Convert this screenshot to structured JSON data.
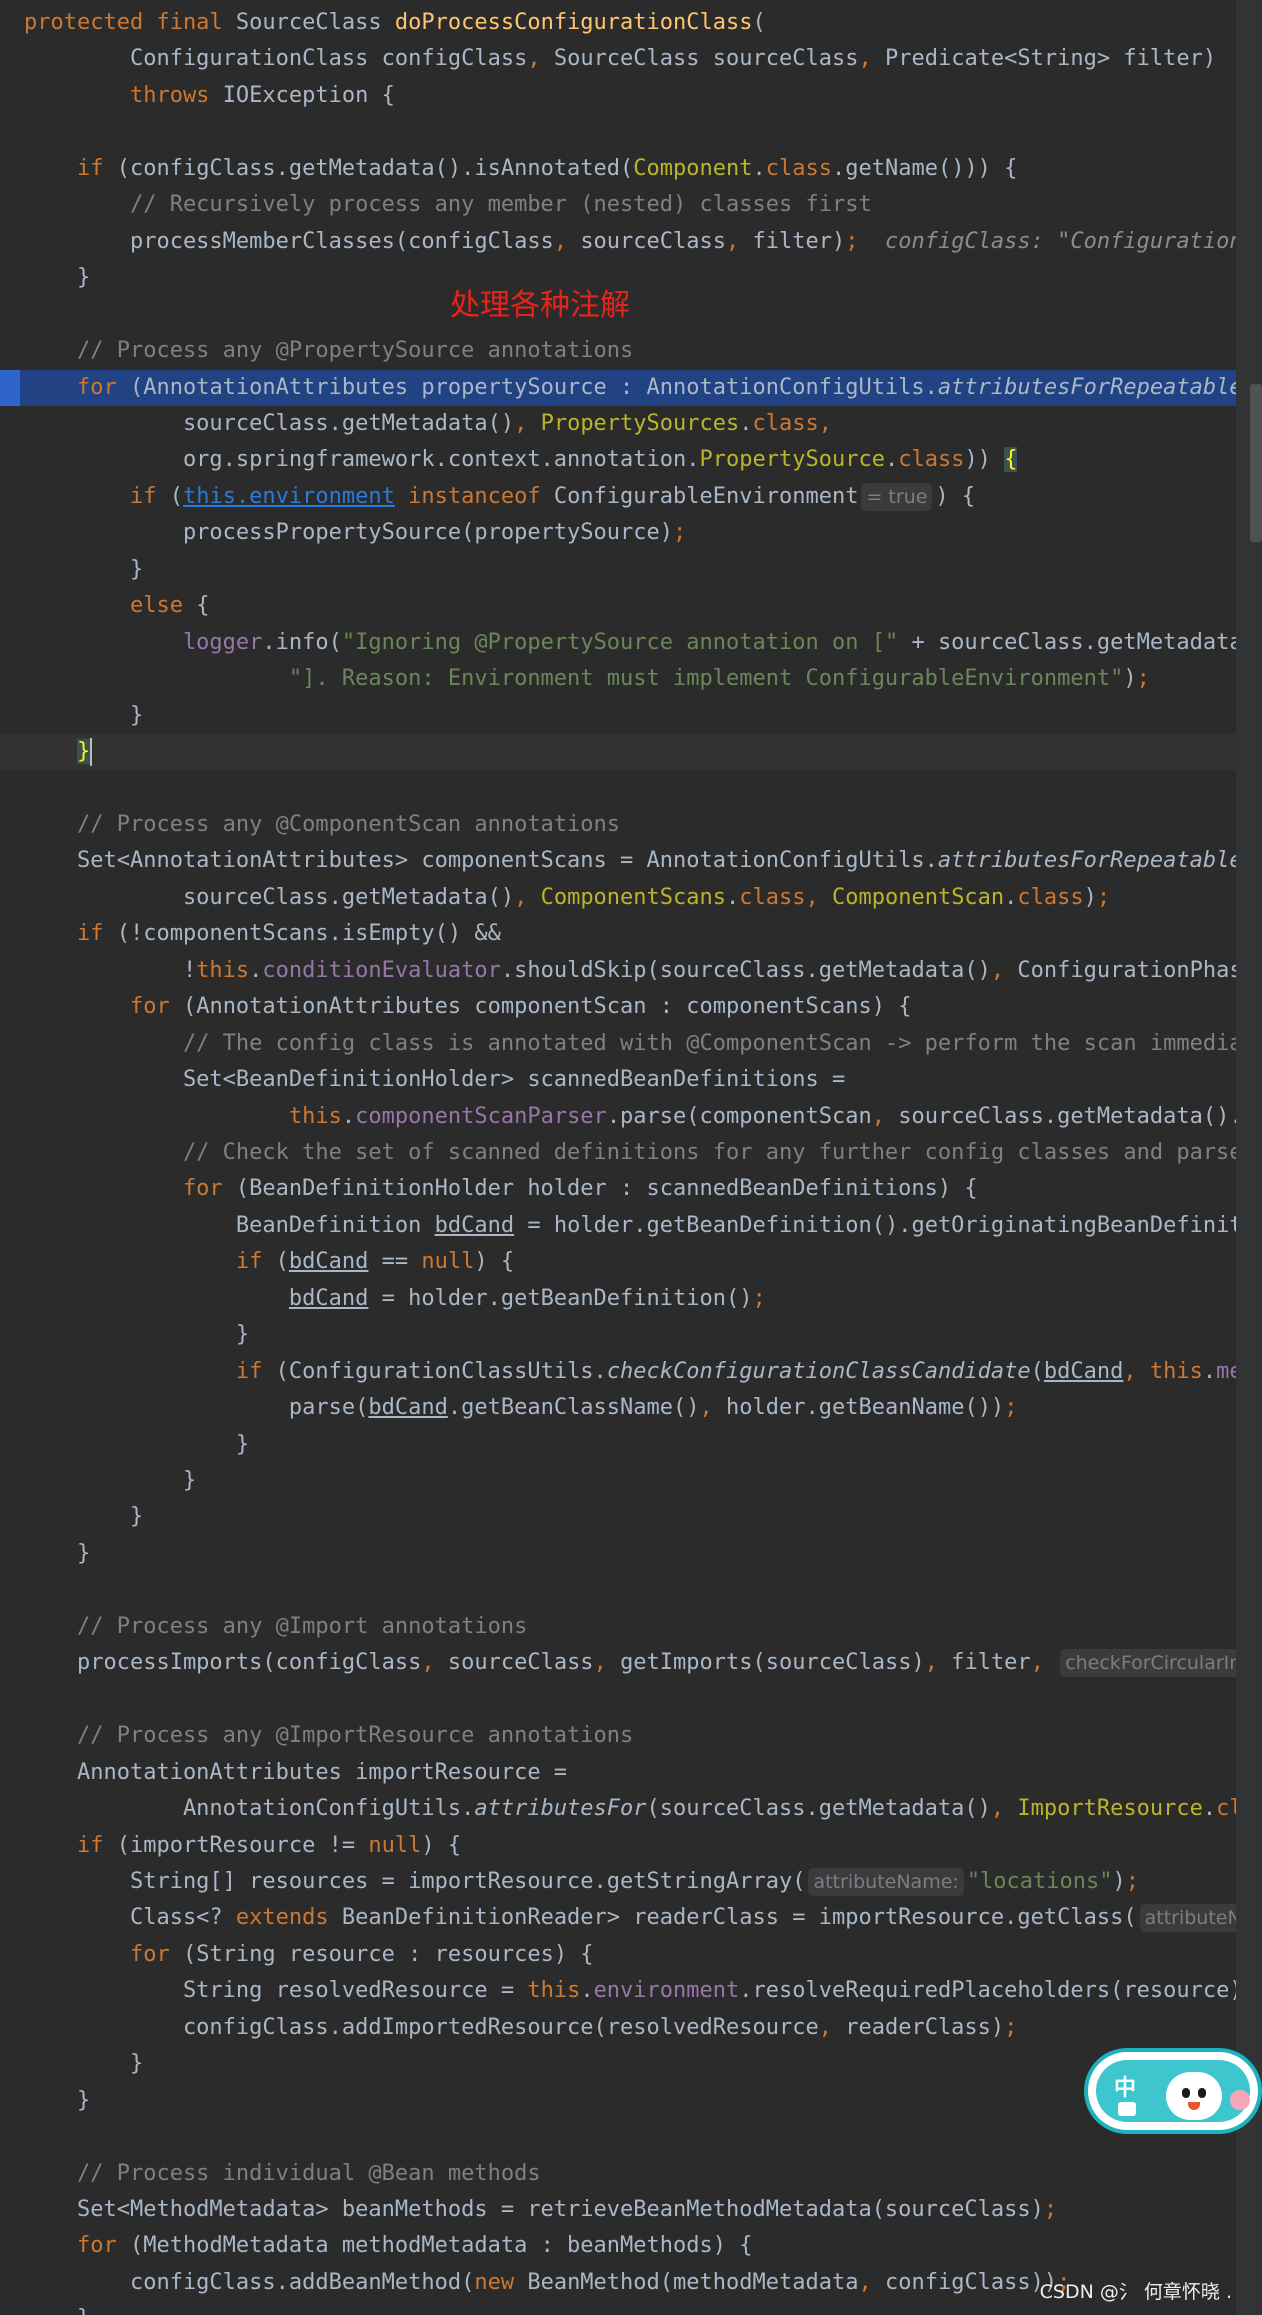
{
  "annotation": "处理各种注解",
  "watermark": "CSDN @氵 何章怀晓 .",
  "ime": {
    "label": "中"
  },
  "lines": [
    {
      "t": [
        [
          "k",
          "protected final "
        ],
        [
          "",
          "SourceClass "
        ],
        [
          "f",
          "doProcessConfigurationClass"
        ],
        [
          "",
          "("
        ]
      ]
    },
    {
      "t": [
        [
          "",
          "        ConfigurationClass configClass"
        ],
        [
          "k",
          ", "
        ],
        [
          "",
          "SourceClass sourceClass"
        ],
        [
          "k",
          ", "
        ],
        [
          "",
          "Predicate<String> filter)  "
        ],
        [
          "hint",
          "c"
        ]
      ]
    },
    {
      "t": [
        [
          "k",
          "        throws "
        ],
        [
          "",
          "IOException {"
        ]
      ]
    },
    {
      "t": []
    },
    {
      "t": [
        [
          "k",
          "    if "
        ],
        [
          "",
          "(configClass.getMetadata().isAnnotated("
        ],
        [
          "a",
          "Component"
        ],
        [
          "",
          "."
        ],
        [
          "k",
          "class"
        ],
        [
          "",
          ".getName())) {"
        ]
      ]
    },
    {
      "t": [
        [
          "c",
          "        // Recursively process any member (nested) classes first"
        ]
      ]
    },
    {
      "t": [
        [
          "",
          "        processMemberClasses(configClass"
        ],
        [
          "k",
          ", "
        ],
        [
          "",
          "sourceClass"
        ],
        [
          "k",
          ", "
        ],
        [
          "",
          "filter)"
        ],
        [
          "k",
          ";"
        ],
        [
          "hint",
          "  configClass: \"ConfigurationC"
        ]
      ]
    },
    {
      "t": [
        [
          "",
          "    }"
        ]
      ]
    },
    {
      "t": []
    },
    {
      "t": [
        [
          "c",
          "    // Process any @PropertySource annotations"
        ]
      ]
    },
    {
      "cls": "selected",
      "t": [
        [
          "k",
          "    for "
        ],
        [
          "",
          "(AnnotationAttributes propertySource : AnnotationConfigUtils."
        ],
        [
          "i",
          "attributesForRepeatable"
        ],
        [
          "",
          "("
        ]
      ]
    },
    {
      "t": [
        [
          "",
          "            sourceClass.getMetadata()"
        ],
        [
          "k",
          ", "
        ],
        [
          "a",
          "PropertySources"
        ],
        [
          "",
          "."
        ],
        [
          "k",
          "class,"
        ]
      ]
    },
    {
      "t": [
        [
          "",
          "            org.springframework.context.annotation."
        ],
        [
          "a",
          "PropertySource"
        ],
        [
          "",
          "."
        ],
        [
          "k",
          "class"
        ],
        [
          "",
          ")) "
        ],
        [
          "bm",
          "{"
        ]
      ]
    },
    {
      "t": [
        [
          "k",
          "        if "
        ],
        [
          "",
          "("
        ],
        [
          "lk",
          "this.environment"
        ],
        [
          "",
          " "
        ],
        [
          "k",
          "instanceof "
        ],
        [
          "",
          "ConfigurableEnvironment"
        ],
        [
          "hintbox",
          "= true"
        ],
        [
          "",
          ") {"
        ]
      ]
    },
    {
      "t": [
        [
          "",
          "            processPropertySource(propertySource)"
        ],
        [
          "k",
          ";"
        ]
      ]
    },
    {
      "t": [
        [
          "",
          "        }"
        ]
      ]
    },
    {
      "t": [
        [
          "k",
          "        else "
        ],
        [
          "",
          "{"
        ]
      ]
    },
    {
      "t": [
        [
          "p",
          "            logger"
        ],
        [
          "",
          ".info("
        ],
        [
          "s",
          "\"Ignoring @PropertySource annotation on [\""
        ],
        [
          "",
          " + sourceClass.getMetadata()."
        ]
      ]
    },
    {
      "t": [
        [
          "s",
          "                    \"]. Reason: Environment must implement ConfigurableEnvironment\""
        ],
        [
          "",
          ")"
        ],
        [
          "k",
          ";"
        ]
      ]
    },
    {
      "t": [
        [
          "",
          "        }"
        ]
      ]
    },
    {
      "cls": "current",
      "t": [
        [
          "",
          "    "
        ],
        [
          "bm",
          "}"
        ],
        [
          "caret",
          ""
        ]
      ]
    },
    {
      "t": []
    },
    {
      "t": [
        [
          "c",
          "    // Process any @ComponentScan annotations"
        ]
      ]
    },
    {
      "t": [
        [
          "",
          "    Set<AnnotationAttributes> componentScans = AnnotationConfigUtils."
        ],
        [
          "i",
          "attributesForRepeatable"
        ],
        [
          "",
          "("
        ]
      ]
    },
    {
      "t": [
        [
          "",
          "            sourceClass.getMetadata()"
        ],
        [
          "k",
          ", "
        ],
        [
          "a",
          "ComponentScans"
        ],
        [
          "",
          "."
        ],
        [
          "k",
          "class, "
        ],
        [
          "a",
          "ComponentScan"
        ],
        [
          "",
          "."
        ],
        [
          "k",
          "class"
        ],
        [
          "",
          ")"
        ],
        [
          "k",
          ";"
        ]
      ]
    },
    {
      "t": [
        [
          "k",
          "    if "
        ],
        [
          "",
          "(!componentScans.isEmpty() &&"
        ]
      ]
    },
    {
      "t": [
        [
          "",
          "            !"
        ],
        [
          "k",
          "this"
        ],
        [
          "",
          "."
        ],
        [
          "p",
          "conditionEvaluator"
        ],
        [
          "",
          ".shouldSkip(sourceClass.getMetadata()"
        ],
        [
          "k",
          ", "
        ],
        [
          "",
          "ConfigurationPhase."
        ]
      ]
    },
    {
      "t": [
        [
          "k",
          "        for "
        ],
        [
          "",
          "(AnnotationAttributes componentScan : componentScans) {"
        ]
      ]
    },
    {
      "t": [
        [
          "c",
          "            // The config class is annotated with @ComponentScan -> perform the scan immediately"
        ]
      ]
    },
    {
      "t": [
        [
          "",
          "            Set<BeanDefinitionHolder> scannedBeanDefinitions ="
        ]
      ]
    },
    {
      "t": [
        [
          "k",
          "                    this"
        ],
        [
          "",
          "."
        ],
        [
          "p",
          "componentScanParser"
        ],
        [
          "",
          ".parse(componentScan"
        ],
        [
          "k",
          ", "
        ],
        [
          "",
          "sourceClass.getMetadata().getClassName())"
        ]
      ]
    },
    {
      "t": [
        [
          "c",
          "            // Check the set of scanned definitions for any further config classes and parse recursively"
        ]
      ]
    },
    {
      "t": [
        [
          "k",
          "            for "
        ],
        [
          "",
          "(BeanDefinitionHolder holder : scannedBeanDefinitions) {"
        ]
      ]
    },
    {
      "t": [
        [
          "",
          "                BeanDefinition "
        ],
        [
          "u",
          "bdCand"
        ],
        [
          "",
          " = holder.getBeanDefinition().getOriginatingBeanDefinition()"
        ]
      ]
    },
    {
      "t": [
        [
          "k",
          "                if "
        ],
        [
          "",
          "("
        ],
        [
          "u",
          "bdCand"
        ],
        [
          "",
          " == "
        ],
        [
          "k",
          "null"
        ],
        [
          "",
          ") {"
        ]
      ]
    },
    {
      "t": [
        [
          "",
          "                    "
        ],
        [
          "u",
          "bdCand"
        ],
        [
          "",
          " = holder.getBeanDefinition()"
        ],
        [
          "k",
          ";"
        ]
      ]
    },
    {
      "t": [
        [
          "",
          "                }"
        ]
      ]
    },
    {
      "t": [
        [
          "k",
          "                if "
        ],
        [
          "",
          "(ConfigurationClassUtils."
        ],
        [
          "i",
          "checkConfigurationClassCandidate"
        ],
        [
          "",
          "("
        ],
        [
          "u",
          "bdCand"
        ],
        [
          "k",
          ", this"
        ],
        [
          "",
          "."
        ],
        [
          "p",
          "metadataReaderFactory"
        ]
      ]
    },
    {
      "t": [
        [
          "",
          "                    parse("
        ],
        [
          "u",
          "bdCand"
        ],
        [
          "",
          ".getBeanClassName()"
        ],
        [
          "k",
          ", "
        ],
        [
          "",
          "holder.getBeanName())"
        ],
        [
          "k",
          ";"
        ]
      ]
    },
    {
      "t": [
        [
          "",
          "                }"
        ]
      ]
    },
    {
      "t": [
        [
          "",
          "            }"
        ]
      ]
    },
    {
      "t": [
        [
          "",
          "        }"
        ]
      ]
    },
    {
      "t": [
        [
          "",
          "    }"
        ]
      ]
    },
    {
      "t": []
    },
    {
      "t": [
        [
          "c",
          "    // Process any @Import annotations"
        ]
      ]
    },
    {
      "t": [
        [
          "",
          "    processImports(configClass"
        ],
        [
          "k",
          ", "
        ],
        [
          "",
          "sourceClass"
        ],
        [
          "k",
          ", "
        ],
        [
          "",
          "getImports(sourceClass)"
        ],
        [
          "k",
          ", "
        ],
        [
          "",
          "filter"
        ],
        [
          "k",
          ", "
        ],
        [
          "hintbox",
          "checkForCircularImports:"
        ]
      ]
    },
    {
      "t": []
    },
    {
      "t": [
        [
          "c",
          "    // Process any @ImportResource annotations"
        ]
      ]
    },
    {
      "t": [
        [
          "",
          "    AnnotationAttributes importResource ="
        ]
      ]
    },
    {
      "t": [
        [
          "",
          "            AnnotationConfigUtils."
        ],
        [
          "i",
          "attributesFor"
        ],
        [
          "",
          "(sourceClass.getMetadata()"
        ],
        [
          "k",
          ", "
        ],
        [
          "a",
          "ImportResource"
        ],
        [
          "",
          "."
        ],
        [
          "k",
          "class"
        ],
        [
          "",
          ")"
        ],
        [
          "k",
          ";"
        ]
      ]
    },
    {
      "t": [
        [
          "k",
          "    if "
        ],
        [
          "",
          "(importResource != "
        ],
        [
          "k",
          "null"
        ],
        [
          "",
          ") {"
        ]
      ]
    },
    {
      "t": [
        [
          "",
          "        String[] resources = importResource.getStringArray("
        ],
        [
          "hintbox",
          "attributeName:"
        ],
        [
          "s",
          "\"locations\""
        ],
        [
          "",
          ")"
        ],
        [
          "k",
          ";"
        ]
      ]
    },
    {
      "t": [
        [
          "",
          "        Class<? "
        ],
        [
          "k",
          "extends "
        ],
        [
          "",
          "BeanDefinitionReader> readerClass = importResource.getClass("
        ],
        [
          "hintbox",
          "attributeName:"
        ]
      ]
    },
    {
      "t": [
        [
          "k",
          "        for "
        ],
        [
          "",
          "(String resource : resources) {"
        ]
      ]
    },
    {
      "t": [
        [
          "",
          "            String resolvedResource = "
        ],
        [
          "k",
          "this"
        ],
        [
          "",
          "."
        ],
        [
          "p",
          "environment"
        ],
        [
          "",
          ".resolveRequiredPlaceholders(resource)"
        ],
        [
          "k",
          ";"
        ]
      ]
    },
    {
      "t": [
        [
          "",
          "            configClass.addImportedResource(resolvedResource"
        ],
        [
          "k",
          ", "
        ],
        [
          "",
          "readerClass)"
        ],
        [
          "k",
          ";"
        ]
      ]
    },
    {
      "t": [
        [
          "",
          "        }"
        ]
      ]
    },
    {
      "t": [
        [
          "",
          "    }"
        ]
      ]
    },
    {
      "t": []
    },
    {
      "t": [
        [
          "c",
          "    // Process individual @Bean methods"
        ]
      ]
    },
    {
      "t": [
        [
          "",
          "    Set<MethodMetadata> beanMethods = retrieveBeanMethodMetadata(sourceClass)"
        ],
        [
          "k",
          ";"
        ]
      ]
    },
    {
      "t": [
        [
          "k",
          "    for "
        ],
        [
          "",
          "(MethodMetadata methodMetadata : beanMethods) {"
        ]
      ]
    },
    {
      "t": [
        [
          "",
          "        configClass.addBeanMethod("
        ],
        [
          "k",
          "new "
        ],
        [
          "",
          "BeanMethod(methodMetadata"
        ],
        [
          "k",
          ", "
        ],
        [
          "",
          "configClass))"
        ],
        [
          "k",
          ";"
        ]
      ]
    },
    {
      "t": [
        [
          "",
          "    }"
        ]
      ]
    }
  ]
}
